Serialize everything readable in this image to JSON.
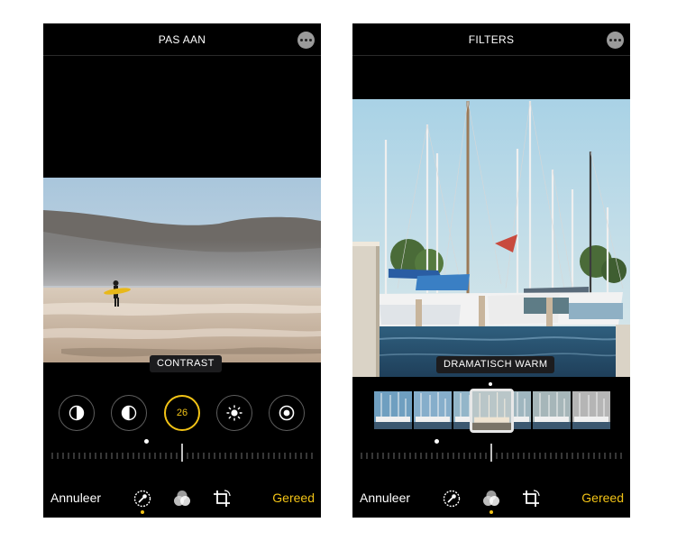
{
  "left_screen": {
    "title": "PAS AAN",
    "selected_adjustment": "CONTRAST",
    "adjustment_value": "26",
    "adjustments": [
      "exposure-icon",
      "brilliance-icon",
      "contrast-value",
      "brightness-icon",
      "vignette-icon"
    ],
    "cancel_label": "Annuleer",
    "done_label": "Gereed",
    "active_tool": "adjust-icon"
  },
  "right_screen": {
    "title": "FILTERS",
    "selected_filter": "DRAMATISCH WARM",
    "cancel_label": "Annuleer",
    "done_label": "Gereed",
    "active_tool": "filters-icon"
  },
  "colors": {
    "accent": "#f2c316",
    "background": "#000000",
    "text": "#ffffff"
  }
}
